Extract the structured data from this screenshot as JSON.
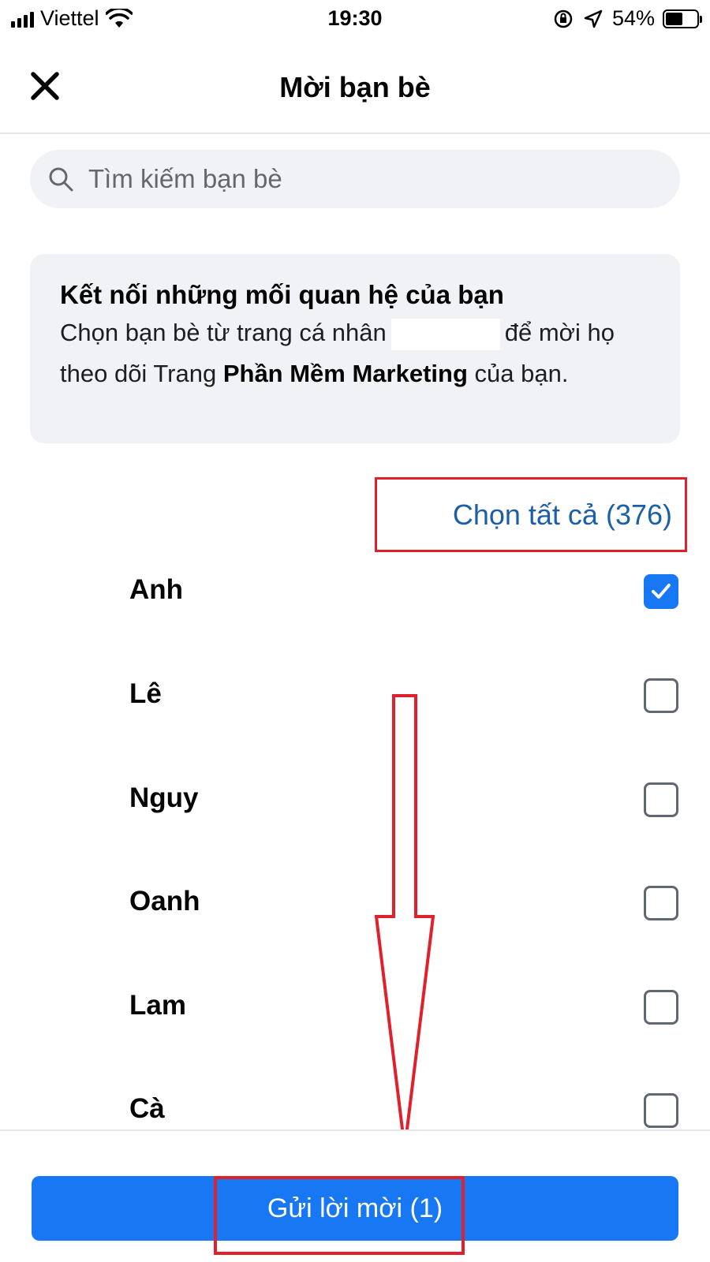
{
  "status_bar": {
    "carrier": "Viettel",
    "time": "19:30",
    "battery_percent": "54%",
    "battery_level": 0.54
  },
  "header": {
    "title": "Mời bạn bè",
    "close_icon": "close-icon"
  },
  "search": {
    "placeholder": "Tìm kiếm bạn bè",
    "icon": "search-icon"
  },
  "info_card": {
    "title": "Kết nối những mối quan hệ của bạn",
    "body_part1": "Chọn bạn bè từ trang cá nhân",
    "body_part2": "để mời họ theo dõi Trang",
    "page_name": "Phần Mềm Marketing",
    "body_part3": "của bạn."
  },
  "select_all": {
    "label": "Chọn tất cả (376)"
  },
  "friends": [
    {
      "name": "Anh",
      "checked": true
    },
    {
      "name": "Lê",
      "checked": false
    },
    {
      "name": "Nguy",
      "checked": false
    },
    {
      "name": "Oanh",
      "checked": false
    },
    {
      "name": "Lam",
      "checked": false
    },
    {
      "name": "Cà",
      "checked": false
    }
  ],
  "send_button": {
    "label": "Gửi lời mời  (1)"
  },
  "colors": {
    "accent": "#1877f2",
    "link": "#1b5fa8",
    "annotation_red": "#e0212c",
    "panel_bg": "#f0f2f5"
  }
}
